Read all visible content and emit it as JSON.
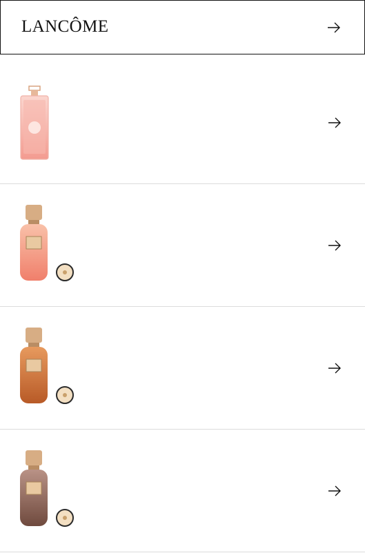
{
  "brand": {
    "logo_text": "LANCÔME",
    "arrow_icon": "arrow-right-icon"
  },
  "products": [
    {
      "name": "idole-perfume-bottle",
      "icon": "arrow-right-icon",
      "colors": {
        "glass": "#f6b4aa",
        "liquid": "#f39b90",
        "cap": "#d9a380"
      }
    },
    {
      "name": "absolue-rose-bottle",
      "icon": "arrow-right-icon",
      "colors": {
        "glass": "#f7b49a",
        "liquid": "#f07f6b",
        "cap": "#c99a6a"
      }
    },
    {
      "name": "absolue-amber-bottle",
      "icon": "arrow-right-icon",
      "colors": {
        "glass": "#e2884d",
        "liquid": "#b85a27",
        "cap": "#c99a6a"
      }
    },
    {
      "name": "absolue-brown-bottle",
      "icon": "arrow-right-icon",
      "colors": {
        "glass": "#a77b6c",
        "liquid": "#6f4a3e",
        "cap": "#c99a6a"
      }
    }
  ]
}
